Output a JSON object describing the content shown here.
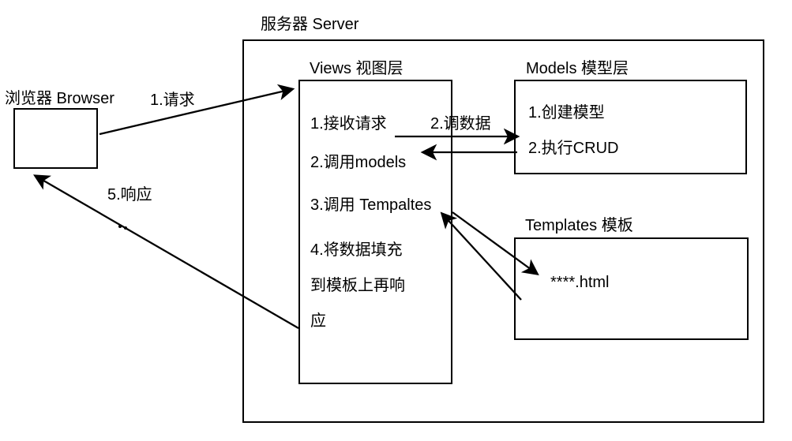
{
  "diagram": {
    "server_title": "服务器 Server",
    "browser_title": "浏览器  Browser",
    "views_title": "Views 视图层",
    "models_title": "Models 模型层",
    "templates_title": "Templates 模板",
    "arrow_request": "1.请求",
    "arrow_response": "5.响应",
    "arrow_data": "2.调数据",
    "views_item1": "1.接收请求",
    "views_item2": "2.调用models",
    "views_item3": "3.调用 Tempaltes",
    "views_item4_line1": "4.将数据填充",
    "views_item4_line2": "到模板上再响",
    "views_item4_line3": "应",
    "models_item1": "1.创建模型",
    "models_item2": "2.执行CRUD",
    "templates_item": "****.html"
  }
}
